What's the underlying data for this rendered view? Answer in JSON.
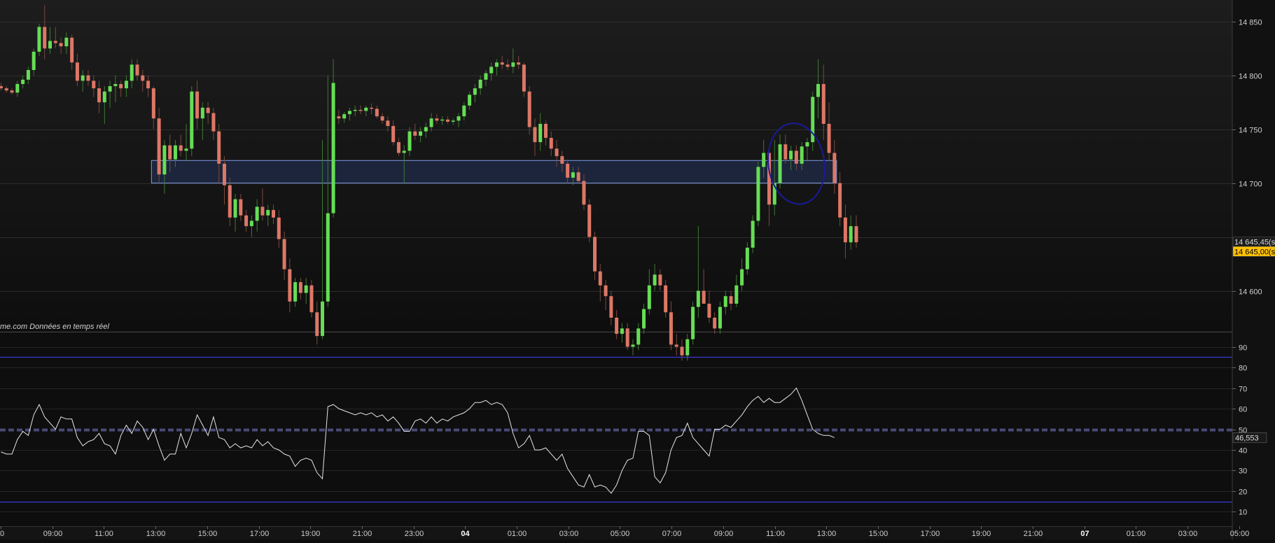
{
  "chart_data": [
    {
      "type": "candlestick",
      "title": "",
      "watermark": "me.com  Données en temps réel",
      "ylim": [
        14562,
        14870
      ],
      "y_ticks": [
        "14 850",
        "14 800",
        "14 750",
        "14 700",
        "14 600"
      ],
      "y_tick_values": [
        14850,
        14800,
        14750,
        14700,
        14600
      ],
      "price_labels": [
        {
          "text": "14 645,45(s",
          "value": 14645.45,
          "color": "#1c1c1c",
          "text_color": "#dddddd"
        },
        {
          "text": "14 645,00(s",
          "value": 14636.5,
          "color": "#ffc107",
          "text_color": "#000000"
        }
      ],
      "zone": {
        "from_value": 14700,
        "to_value": 14721,
        "start_index": 28,
        "end_index": 153
      },
      "annotation": {
        "type": "ellipse",
        "center_index": 146,
        "center_value": 14718,
        "color": "#1a1a9a"
      },
      "up_color": "#66dd55",
      "down_color": "#dd7766",
      "candles": [
        [
          14790,
          14793,
          14786,
          14788
        ],
        [
          14788,
          14790,
          14784,
          14786
        ],
        [
          14786,
          14788,
          14782,
          14784
        ],
        [
          14784,
          14795,
          14780,
          14792
        ],
        [
          14792,
          14800,
          14788,
          14796
        ],
        [
          14796,
          14808,
          14792,
          14805
        ],
        [
          14805,
          14825,
          14800,
          14822
        ],
        [
          14822,
          14848,
          14818,
          14845
        ],
        [
          14845,
          14865,
          14815,
          14825
        ],
        [
          14825,
          14845,
          14820,
          14832
        ],
        [
          14832,
          14845,
          14825,
          14830
        ],
        [
          14830,
          14835,
          14820,
          14827
        ],
        [
          14827,
          14840,
          14820,
          14835
        ],
        [
          14835,
          14838,
          14805,
          14812
        ],
        [
          14812,
          14820,
          14790,
          14795
        ],
        [
          14795,
          14805,
          14785,
          14800
        ],
        [
          14800,
          14805,
          14790,
          14795
        ],
        [
          14795,
          14800,
          14780,
          14788
        ],
        [
          14788,
          14795,
          14765,
          14775
        ],
        [
          14775,
          14790,
          14755,
          14785
        ],
        [
          14785,
          14795,
          14770,
          14790
        ],
        [
          14790,
          14800,
          14775,
          14792
        ],
        [
          14792,
          14795,
          14780,
          14788
        ],
        [
          14788,
          14800,
          14780,
          14795
        ],
        [
          14795,
          14815,
          14788,
          14810
        ],
        [
          14810,
          14815,
          14795,
          14800
        ],
        [
          14800,
          14805,
          14785,
          14795
        ],
        [
          14795,
          14800,
          14780,
          14788
        ],
        [
          14788,
          14790,
          14750,
          14760
        ],
        [
          14760,
          14770,
          14700,
          14708
        ],
        [
          14708,
          14740,
          14690,
          14735
        ],
        [
          14735,
          14745,
          14710,
          14722
        ],
        [
          14722,
          14740,
          14715,
          14735
        ],
        [
          14735,
          14745,
          14725,
          14730
        ],
        [
          14730,
          14755,
          14720,
          14732
        ],
        [
          14732,
          14790,
          14725,
          14785
        ],
        [
          14785,
          14795,
          14750,
          14760
        ],
        [
          14760,
          14775,
          14740,
          14770
        ],
        [
          14770,
          14775,
          14755,
          14765
        ],
        [
          14765,
          14770,
          14740,
          14748
        ],
        [
          14748,
          14755,
          14700,
          14718
        ],
        [
          14718,
          14725,
          14680,
          14698
        ],
        [
          14698,
          14705,
          14660,
          14668
        ],
        [
          14668,
          14690,
          14655,
          14685
        ],
        [
          14685,
          14690,
          14665,
          14670
        ],
        [
          14670,
          14675,
          14655,
          14660
        ],
        [
          14660,
          14670,
          14650,
          14665
        ],
        [
          14665,
          14685,
          14655,
          14678
        ],
        [
          14678,
          14695,
          14665,
          14670
        ],
        [
          14670,
          14680,
          14660,
          14675
        ],
        [
          14675,
          14680,
          14662,
          14668
        ],
        [
          14668,
          14675,
          14640,
          14648
        ],
        [
          14648,
          14655,
          14610,
          14620
        ],
        [
          14620,
          14630,
          14580,
          14590
        ],
        [
          14590,
          14612,
          14585,
          14608
        ],
        [
          14608,
          14612,
          14592,
          14598
        ],
        [
          14598,
          14612,
          14588,
          14605
        ],
        [
          14605,
          14610,
          14575,
          14580
        ],
        [
          14580,
          14590,
          14550,
          14558
        ],
        [
          14558,
          14740,
          14555,
          14590
        ],
        [
          14590,
          14800,
          14585,
          14672
        ],
        [
          14672,
          14815,
          14668,
          14793
        ],
        [
          14762,
          14768,
          14755,
          14760
        ],
        [
          14760,
          14766,
          14756,
          14764
        ],
        [
          14764,
          14770,
          14758,
          14767
        ],
        [
          14767,
          14772,
          14762,
          14768
        ],
        [
          14768,
          14772,
          14764,
          14767
        ],
        [
          14767,
          14772,
          14762,
          14770
        ],
        [
          14770,
          14774,
          14764,
          14769
        ],
        [
          14769,
          14772,
          14760,
          14762
        ],
        [
          14762,
          14765,
          14755,
          14758
        ],
        [
          14758,
          14762,
          14748,
          14753
        ],
        [
          14753,
          14758,
          14735,
          14738
        ],
        [
          14738,
          14742,
          14725,
          14728
        ],
        [
          14728,
          14735,
          14700,
          14730
        ],
        [
          14730,
          14752,
          14725,
          14748
        ],
        [
          14748,
          14755,
          14740,
          14744
        ],
        [
          14744,
          14752,
          14738,
          14748
        ],
        [
          14748,
          14756,
          14742,
          14752
        ],
        [
          14752,
          14765,
          14748,
          14760
        ],
        [
          14760,
          14764,
          14755,
          14758
        ],
        [
          14758,
          14762,
          14754,
          14759
        ],
        [
          14759,
          14762,
          14755,
          14757
        ],
        [
          14757,
          14760,
          14754,
          14758
        ],
        [
          14758,
          14765,
          14752,
          14762
        ],
        [
          14762,
          14775,
          14758,
          14772
        ],
        [
          14772,
          14785,
          14768,
          14782
        ],
        [
          14782,
          14792,
          14775,
          14788
        ],
        [
          14788,
          14800,
          14782,
          14796
        ],
        [
          14796,
          14805,
          14790,
          14802
        ],
        [
          14802,
          14812,
          14795,
          14808
        ],
        [
          14808,
          14815,
          14800,
          14812
        ],
        [
          14812,
          14818,
          14806,
          14810
        ],
        [
          14810,
          14815,
          14805,
          14808
        ],
        [
          14808,
          14825,
          14802,
          14812
        ],
        [
          14812,
          14818,
          14806,
          14810
        ],
        [
          14810,
          14812,
          14780,
          14785
        ],
        [
          14785,
          14790,
          14745,
          14752
        ],
        [
          14752,
          14760,
          14725,
          14738
        ],
        [
          14738,
          14765,
          14730,
          14755
        ],
        [
          14755,
          14758,
          14735,
          14742
        ],
        [
          14742,
          14748,
          14725,
          14732
        ],
        [
          14732,
          14740,
          14715,
          14725
        ],
        [
          14725,
          14730,
          14710,
          14718
        ],
        [
          14718,
          14722,
          14700,
          14705
        ],
        [
          14705,
          14715,
          14698,
          14710
        ],
        [
          14710,
          14715,
          14700,
          14702
        ],
        [
          14702,
          14708,
          14675,
          14680
        ],
        [
          14680,
          14685,
          14645,
          14650
        ],
        [
          14650,
          14655,
          14610,
          14618
        ],
        [
          14618,
          14625,
          14590,
          14605
        ],
        [
          14605,
          14610,
          14582,
          14595
        ],
        [
          14595,
          14600,
          14568,
          14575
        ],
        [
          14575,
          14582,
          14555,
          14560
        ],
        [
          14560,
          14570,
          14552,
          14565
        ],
        [
          14565,
          14570,
          14545,
          14548
        ],
        [
          14548,
          14555,
          14540,
          14550
        ],
        [
          14550,
          14570,
          14545,
          14565
        ],
        [
          14565,
          14588,
          14560,
          14583
        ],
        [
          14583,
          14620,
          14578,
          14605
        ],
        [
          14605,
          14625,
          14600,
          14615
        ],
        [
          14615,
          14620,
          14600,
          14605
        ],
        [
          14605,
          14610,
          14575,
          14580
        ],
        [
          14580,
          14590,
          14545,
          14550
        ],
        [
          14550,
          14560,
          14540,
          14548
        ],
        [
          14548,
          14555,
          14535,
          14540
        ],
        [
          14540,
          14560,
          14535,
          14555
        ],
        [
          14555,
          14590,
          14550,
          14585
        ],
        [
          14585,
          14660,
          14575,
          14600
        ],
        [
          14600,
          14620,
          14590,
          14588
        ],
        [
          14588,
          14600,
          14570,
          14575
        ],
        [
          14575,
          14580,
          14560,
          14565
        ],
        [
          14565,
          14590,
          14560,
          14585
        ],
        [
          14585,
          14600,
          14578,
          14595
        ],
        [
          14595,
          14600,
          14582,
          14588
        ],
        [
          14588,
          14615,
          14585,
          14605
        ],
        [
          14605,
          14630,
          14600,
          14620
        ],
        [
          14620,
          14645,
          14615,
          14640
        ],
        [
          14640,
          14670,
          14635,
          14665
        ],
        [
          14665,
          14720,
          14660,
          14715
        ],
        [
          14715,
          14740,
          14705,
          14728
        ],
        [
          14728,
          14730,
          14660,
          14680
        ],
        [
          14680,
          14740,
          14670,
          14700
        ],
        [
          14700,
          14745,
          14695,
          14736
        ],
        [
          14736,
          14745,
          14718,
          14722
        ],
        [
          14722,
          14735,
          14712,
          14730
        ],
        [
          14730,
          14735,
          14712,
          14718
        ],
        [
          14718,
          14738,
          14712,
          14734
        ],
        [
          14734,
          14742,
          14720,
          14738
        ],
        [
          14738,
          14785,
          14730,
          14780
        ],
        [
          14780,
          14815,
          14760,
          14792
        ],
        [
          14792,
          14810,
          14740,
          14755
        ],
        [
          14755,
          14775,
          14720,
          14728
        ],
        [
          14728,
          14740,
          14690,
          14700
        ],
        [
          14700,
          14710,
          14660,
          14668
        ],
        [
          14668,
          14680,
          14630,
          14645
        ],
        [
          14645,
          14670,
          14638,
          14660
        ],
        [
          14660,
          14670,
          14640,
          14645
        ]
      ]
    },
    {
      "type": "line",
      "name": "",
      "ylim": [
        3,
        97
      ],
      "y_ticks": [
        "90",
        "80",
        "70",
        "60",
        "50",
        "40",
        "30",
        "20",
        "10"
      ],
      "y_tick_values": [
        90,
        80,
        70,
        60,
        50,
        40,
        30,
        20,
        10
      ],
      "reference_lines": [
        85,
        50,
        15
      ],
      "last_value_label": "46,553",
      "line_color": "#e6e6e6",
      "values": [
        39,
        38,
        38,
        45,
        49,
        47,
        57,
        62,
        56,
        53,
        50,
        56,
        55,
        55,
        46,
        42,
        44,
        45,
        48,
        43,
        42,
        38,
        47,
        52,
        48,
        54,
        51,
        45,
        50,
        42,
        35,
        38,
        38,
        48,
        41,
        48,
        57,
        52,
        47,
        56,
        46,
        45,
        41,
        43,
        41,
        42,
        41,
        45,
        42,
        44,
        41,
        40,
        38,
        37,
        32,
        35,
        36,
        35,
        29,
        26,
        61,
        62,
        60,
        59,
        58,
        57,
        58,
        57,
        58,
        56,
        57,
        54,
        56,
        53,
        49,
        49,
        54,
        55,
        53,
        56,
        53,
        55,
        54,
        56,
        57,
        58,
        60,
        63,
        63,
        64,
        62,
        63,
        62,
        58,
        48,
        41,
        43,
        47,
        40,
        40,
        41,
        38,
        35,
        38,
        31,
        27,
        23,
        22,
        28,
        22,
        23,
        22,
        19,
        23,
        30,
        35,
        36,
        49,
        49,
        47,
        27,
        24,
        29,
        40,
        46,
        47,
        53,
        46,
        43,
        40,
        37,
        50,
        50,
        52,
        51,
        54,
        57,
        61,
        64,
        66,
        63,
        65,
        63,
        63,
        65,
        67,
        70,
        64,
        57,
        50,
        48,
        47,
        47,
        46
      ]
    }
  ],
  "x_axis": {
    "labels": [
      "0",
      "09:00",
      "11:00",
      "13:00",
      "15:00",
      "17:00",
      "19:00",
      "21:00",
      "23:00",
      "04",
      "01:00",
      "03:00",
      "05:00",
      "07:00",
      "09:00",
      "11:00",
      "13:00",
      "15:00",
      "17:00",
      "19:00",
      "21:00",
      "07",
      "01:00",
      "03:00",
      "05:00",
      "07:00"
    ],
    "bold": [
      "04",
      "07"
    ]
  }
}
